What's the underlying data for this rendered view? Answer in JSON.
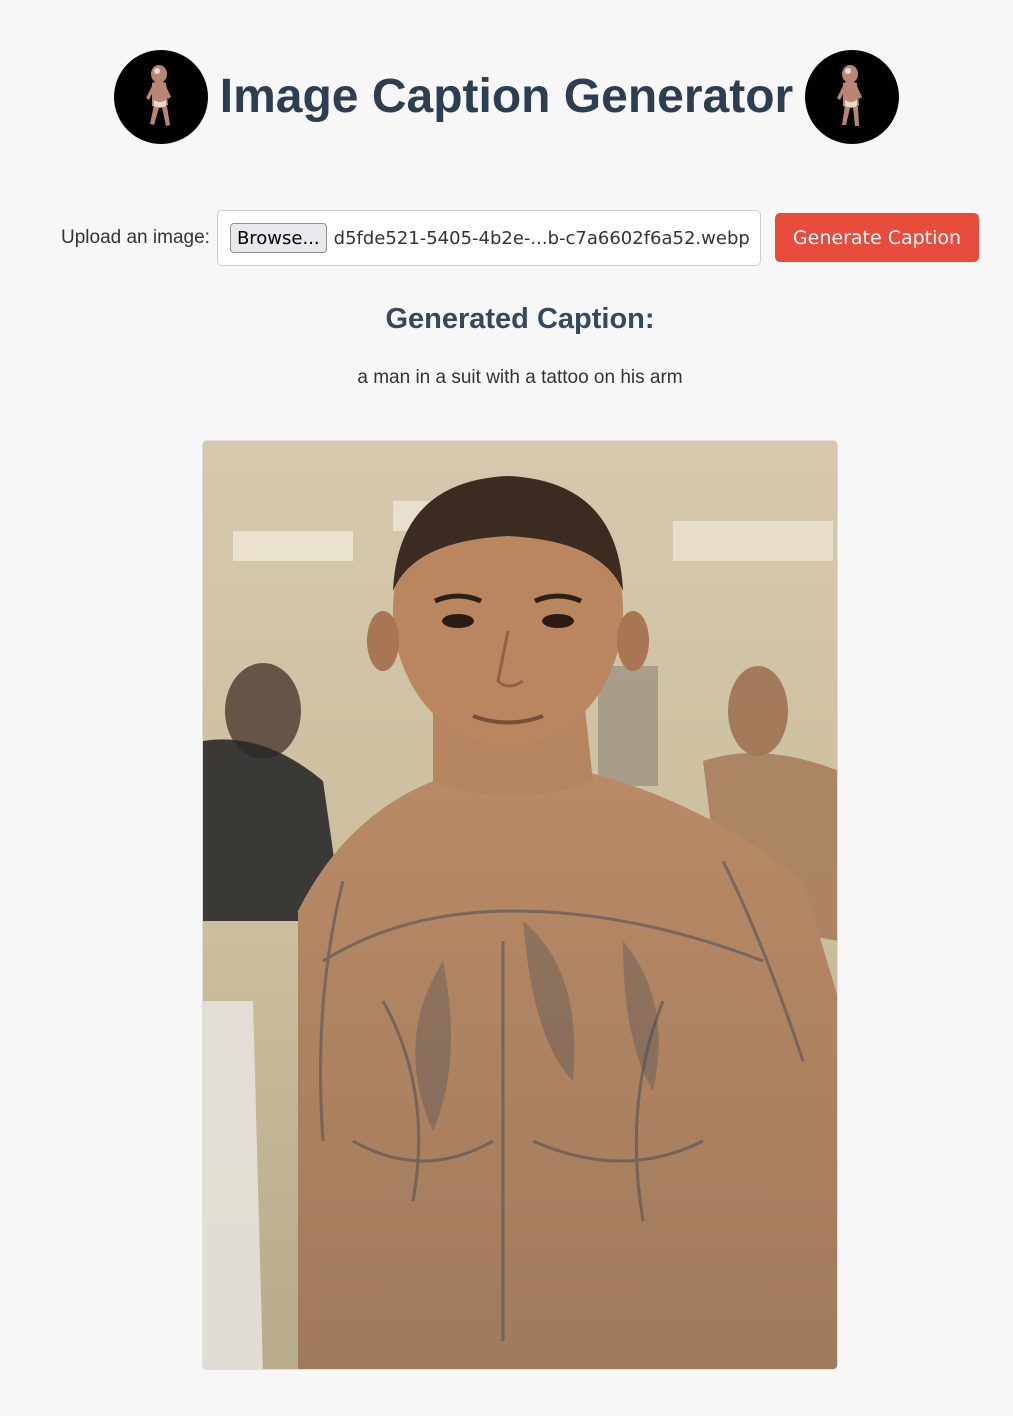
{
  "page": {
    "title": "Image Caption Generator"
  },
  "header": {
    "logo_left_icon": "dancing-baby-icon",
    "logo_right_icon": "dancing-baby-icon"
  },
  "upload": {
    "label": "Upload an image:",
    "browse_label": "Browse...",
    "file_name": "d5fde521-5405-4b2e-...b-c7a6602f6a52.webp"
  },
  "actions": {
    "generate_label": "Generate Caption"
  },
  "result": {
    "heading": "Generated Caption:",
    "caption": "a man in a suit with a tattoo on his arm"
  },
  "colors": {
    "background": "#f7f7f7",
    "title": "#2c3e50",
    "heading": "#34495e",
    "button": "#e74c3c"
  }
}
